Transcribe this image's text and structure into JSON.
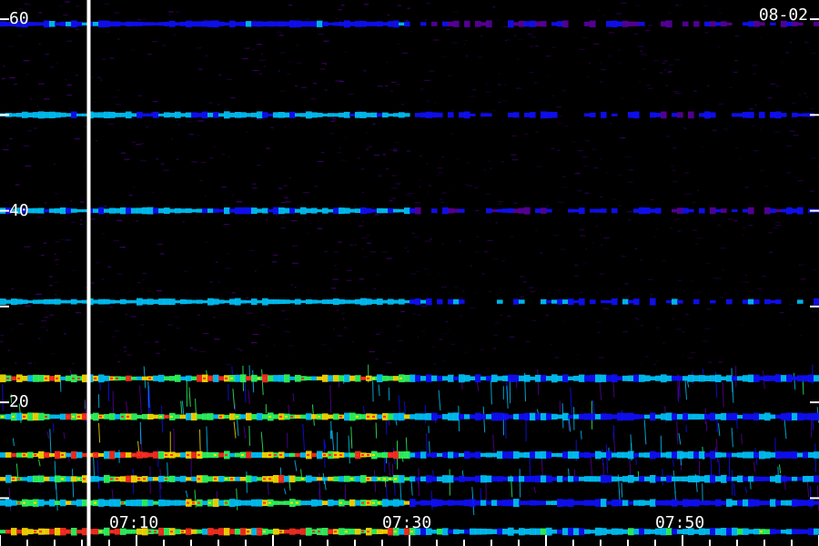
{
  "chart_data": {
    "type": "heatmap",
    "title": "",
    "date_label": "08-02",
    "y_tick_labels": [
      {
        "value": 60,
        "label": "60"
      },
      {
        "value": 50,
        "label": ""
      },
      {
        "value": 40,
        "label": "40"
      },
      {
        "value": 30,
        "label": ""
      },
      {
        "value": 20,
        "label": "20"
      },
      {
        "value": 10,
        "label": ""
      }
    ],
    "x_tick_labels": [
      {
        "value": "07:10",
        "label": "07:10"
      },
      {
        "value": "07:30",
        "label": "07:30"
      },
      {
        "value": "07:50",
        "label": "07:50"
      }
    ],
    "ylim": [
      5,
      62
    ],
    "xlim": [
      "07:00",
      "08:00"
    ],
    "x_minor_tick_step_minutes": 2,
    "marker_line_time": "07:06.5",
    "data_gap_time": "07:30",
    "horizontal_bands": [
      {
        "y": 59.5,
        "intensity": 0.35
      },
      {
        "y": 50,
        "intensity": 0.55
      },
      {
        "y": 40,
        "intensity": 0.45
      },
      {
        "y": 30.5,
        "intensity": 0.75
      },
      {
        "y": 22.5,
        "intensity": 0.85
      },
      {
        "y": 18.5,
        "intensity": 0.8
      },
      {
        "y": 14.5,
        "intensity": 0.9
      },
      {
        "y": 12,
        "intensity": 0.8
      },
      {
        "y": 9.5,
        "intensity": 0.7
      },
      {
        "y": 6.5,
        "intensity": 0.95
      }
    ],
    "colors": {
      "background": "#000000",
      "low": "#5a00a0",
      "mid_low": "#1010ff",
      "mid": "#00c8ff",
      "mid_high": "#30ff60",
      "high": "#ffe000",
      "peak": "#ff3020",
      "axis": "#ffffff"
    }
  }
}
